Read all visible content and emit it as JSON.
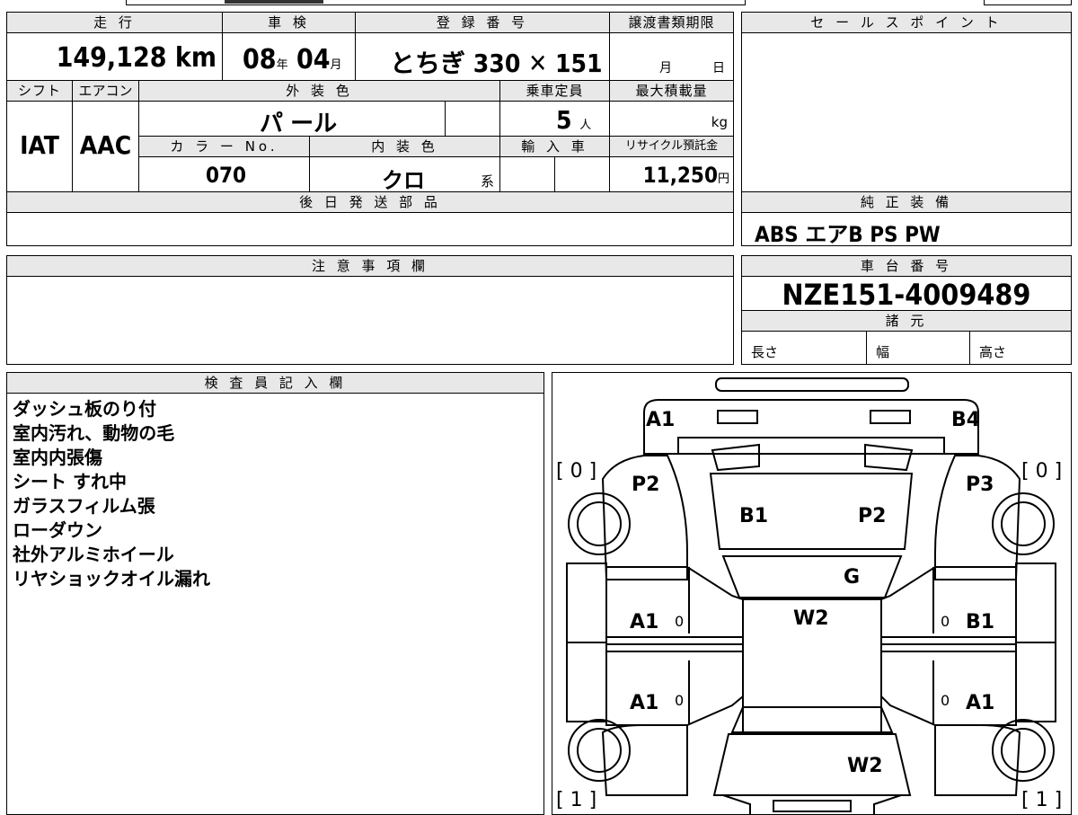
{
  "info": {
    "mileage_label": "走 行",
    "mileage_value": "149,128",
    "mileage_unit": "km",
    "shaken_label": "車 検",
    "shaken_year": "08",
    "shaken_year_unit": "年",
    "shaken_month": "04",
    "shaken_month_unit": "月",
    "reg_label": "登 録 番 号",
    "reg_value": "とちぎ 330 ✕ 151",
    "transfer_label": "譲渡書類期限",
    "transfer_month": "月",
    "transfer_day": "日",
    "shift_label": "シフト",
    "shift_value": "IAT",
    "ac_label": "エアコン",
    "ac_value": "AAC",
    "exterior_label": "外 装 色",
    "exterior_value": "パ ール",
    "capacity_label": "乗車定員",
    "capacity_value": "5",
    "capacity_unit": "人",
    "maxload_label": "最大積載量",
    "maxload_unit": "kg",
    "colorno_label": "カ ラ ー No.",
    "colorno_value": "070",
    "interior_label": "内 装 色",
    "interior_value": "クロ",
    "interior_unit": "系",
    "import_label": "輸 入 車",
    "recycle_label": "リサイクル預託金",
    "recycle_value": "11,250",
    "recycle_unit": "円",
    "later_parts_label": "後 日 発 送 部 品"
  },
  "sales": {
    "label": "セ ー ル ス ポ イ ン ト"
  },
  "equipment": {
    "label": "純 正 装 備",
    "value": "ABS エアB PS PW"
  },
  "caution": {
    "label": "注 意 事 項 欄"
  },
  "chassis": {
    "label": "車 台 番 号",
    "value": "NZE151-4009489",
    "spec_label": "諸 元",
    "length_label": "長さ",
    "width_label": "幅",
    "height_label": "高さ"
  },
  "inspector": {
    "label": "検 査 員 記 入 欄",
    "notes": [
      "ダッシュ板のり付",
      "室内汚れ、動物の毛",
      "室内内張傷",
      "シート すれ中",
      "ガラスフィルム張",
      "ローダウン",
      "社外アルミホイール",
      "リヤショックオイル漏れ"
    ]
  },
  "diagram": {
    "front_left": "A1",
    "front_right": "B4",
    "bracket_tl": "[ 0 ]",
    "bracket_tr": "[ 0 ]",
    "bracket_bl": "[ 1 ]",
    "bracket_br": "[ 1 ]",
    "fender_left": "P2",
    "fender_right": "P3",
    "hood_left": "B1",
    "hood_right": "P2",
    "glass": "G",
    "roof": "W2",
    "front_door_left": "A1",
    "front_door_left_n": "0",
    "front_door_right": "B1",
    "front_door_right_n": "0",
    "rear_door_left": "A1",
    "rear_door_left_n": "0",
    "rear_door_right": "A1",
    "rear_door_right_n": "0",
    "trunk": "W2"
  }
}
